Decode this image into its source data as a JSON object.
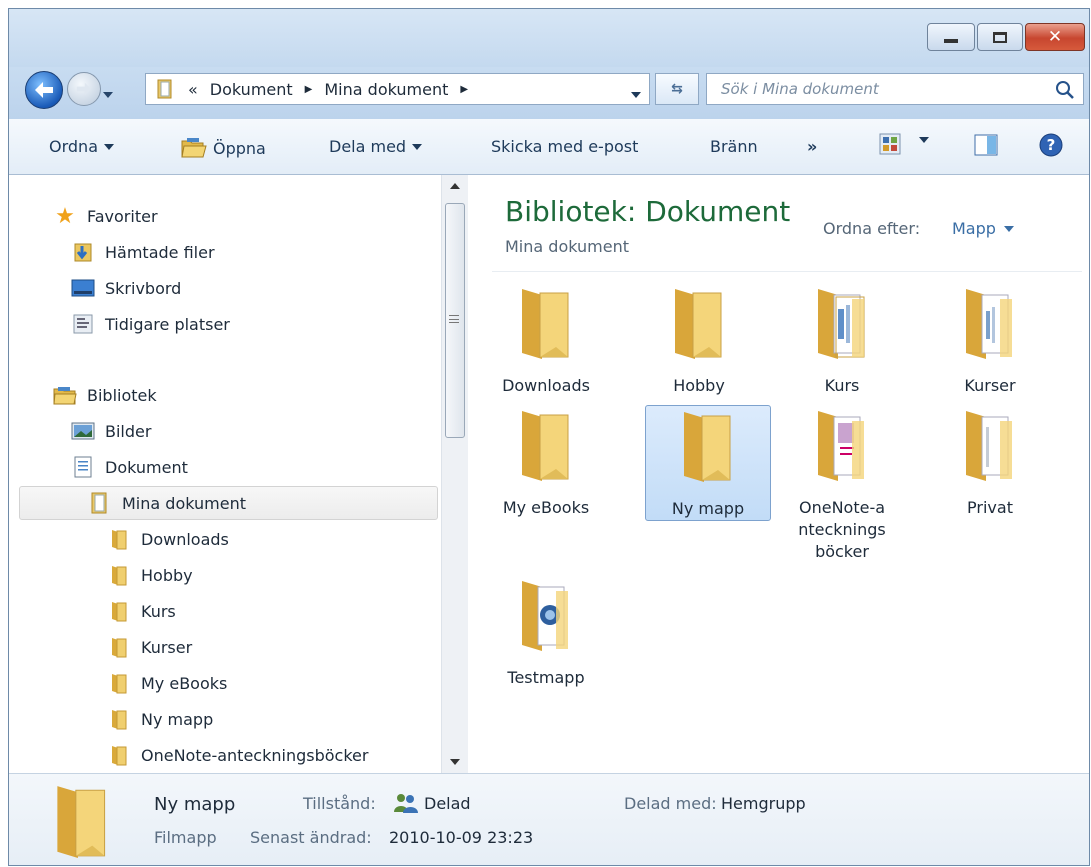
{
  "window": {
    "buttons": [
      "minimize",
      "maximize",
      "close"
    ]
  },
  "address": {
    "overflow": "«",
    "crumbs": [
      "Dokument",
      "Mina dokument"
    ],
    "search_placeholder": "Sök i Mina dokument"
  },
  "toolbar": {
    "organize": "Ordna",
    "open": "Öppna",
    "share": "Dela med",
    "email": "Skicka med e-post",
    "burn": "Bränn",
    "more": "»"
  },
  "nav": {
    "favorites": "Favoriter",
    "downloads_fav": "Hämtade filer",
    "desktop": "Skrivbord",
    "recent": "Tidigare platser",
    "libraries": "Bibliotek",
    "pictures": "Bilder",
    "documents": "Dokument",
    "my_documents": "Mina dokument",
    "subfolders": [
      "Downloads",
      "Hobby",
      "Kurs",
      "Kurser",
      "My eBooks",
      "Ny mapp",
      "OneNote-anteckningsböcker"
    ]
  },
  "content": {
    "title": "Bibliotek: Dokument",
    "subtitle": "Mina dokument",
    "sort_label": "Ordna efter:",
    "sort_value": "Mapp",
    "folders": [
      {
        "name": "Downloads"
      },
      {
        "name": "Hobby"
      },
      {
        "name": "Kurs"
      },
      {
        "name": "Kurser"
      },
      {
        "name": "My eBooks"
      },
      {
        "name": "Ny mapp",
        "selected": true
      },
      {
        "name": "OneNote-a\nntecknings\nböcker"
      },
      {
        "name": "Privat"
      },
      {
        "name": "Testmapp"
      }
    ]
  },
  "details": {
    "name": "Ny mapp",
    "type": "Filmapp",
    "state_label": "Tillstånd:",
    "state_value": "Delad",
    "modified_label": "Senast ändrad:",
    "modified_value": "2010-10-09 23:23",
    "shared_label": "Delad med:",
    "shared_value": "Hemgrupp"
  }
}
